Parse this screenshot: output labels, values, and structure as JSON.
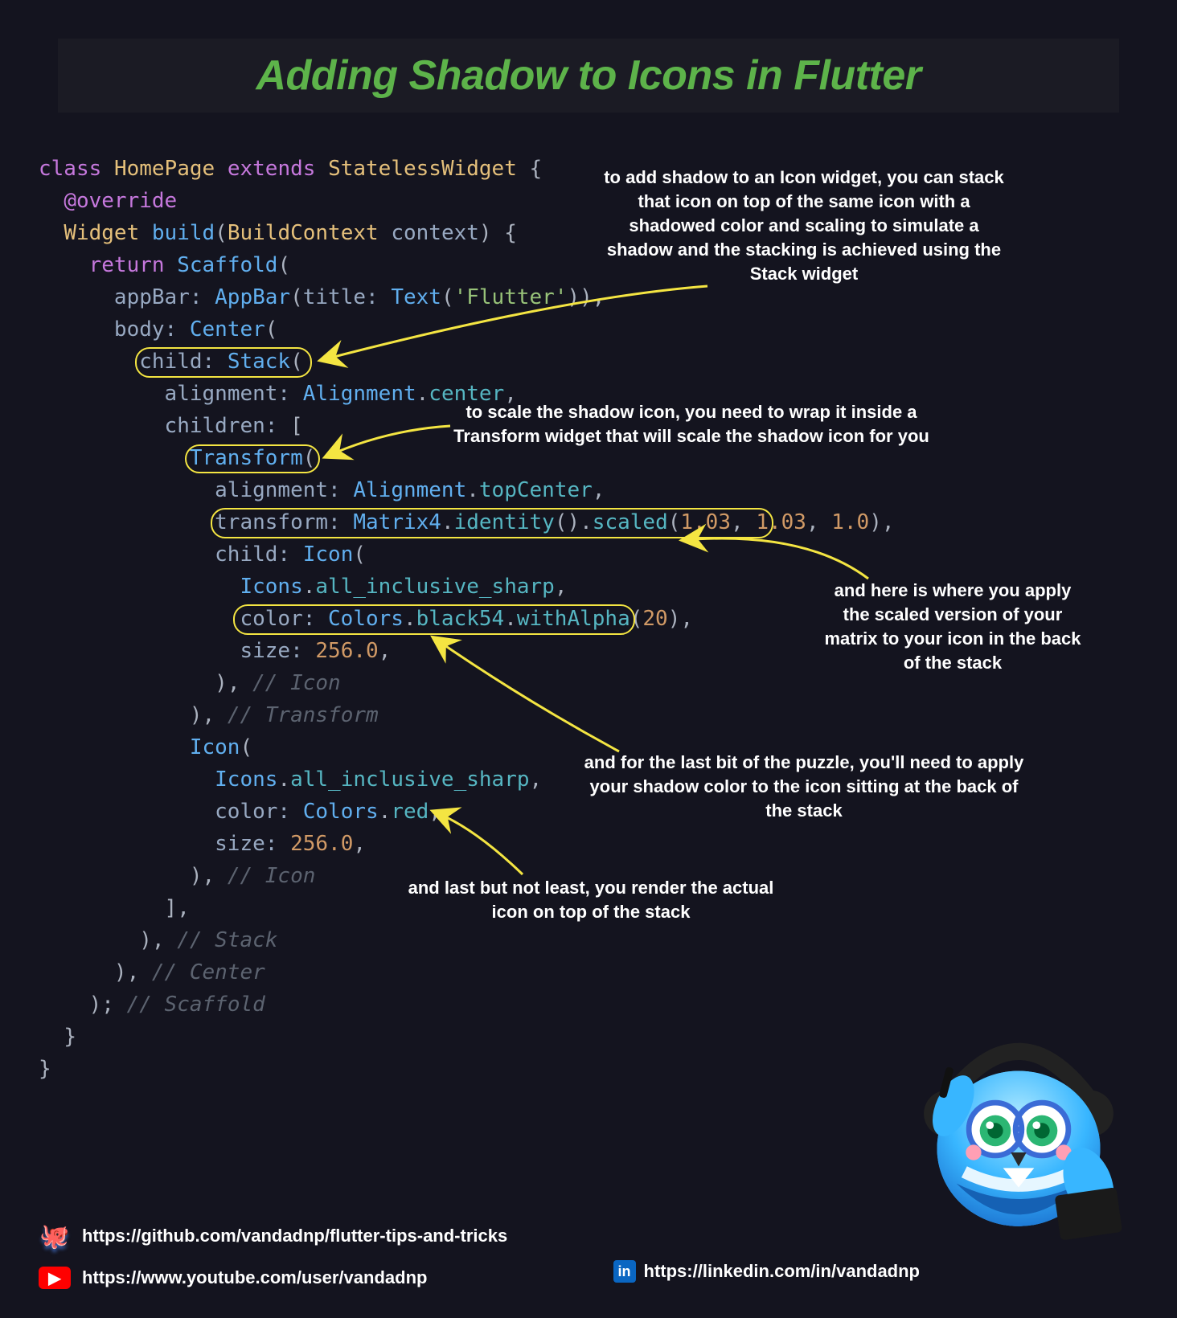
{
  "title": "Adding Shadow to Icons in Flutter",
  "annotations": {
    "stack": "to add shadow to an Icon widget, you can stack that icon on top of the same icon with a shadowed color and scaling to simulate a shadow and the stacking is achieved using the Stack widget",
    "transform": "to scale the shadow icon, you need to wrap it inside a Transform widget that will scale the shadow icon for you",
    "scaled": "and here is where you apply the scaled version of your matrix to your icon in the back of the stack",
    "shadowColor": "and for the last bit of the puzzle, you'll need to apply your shadow color to the icon sitting at the back of the stack",
    "actualIcon": "and last but not least, you render the actual icon on top of the stack"
  },
  "code": {
    "tokens": [
      [
        "kw",
        "class"
      ],
      [
        "",
        " "
      ],
      [
        "type",
        "HomePage"
      ],
      [
        "",
        " "
      ],
      [
        "kw",
        "extends"
      ],
      [
        "",
        " "
      ],
      [
        "type",
        "StatelessWidget"
      ],
      [
        "",
        " "
      ],
      [
        "pun",
        "{"
      ],
      [
        "nl"
      ],
      [
        "",
        "  "
      ],
      [
        "at",
        "@override"
      ],
      [
        "nl"
      ],
      [
        "",
        "  "
      ],
      [
        "type",
        "Widget"
      ],
      [
        "",
        " "
      ],
      [
        "fn",
        "build"
      ],
      [
        "pun",
        "("
      ],
      [
        "type",
        "BuildContext"
      ],
      [
        "",
        " "
      ],
      [
        "prop",
        "context"
      ],
      [
        "pun",
        ")"
      ],
      [
        "",
        " "
      ],
      [
        "pun",
        "{"
      ],
      [
        "nl"
      ],
      [
        "",
        "    "
      ],
      [
        "kw",
        "return"
      ],
      [
        "",
        " "
      ],
      [
        "fn",
        "Scaffold"
      ],
      [
        "pun",
        "("
      ],
      [
        "nl"
      ],
      [
        "",
        "      "
      ],
      [
        "prop",
        "appBar:"
      ],
      [
        "",
        " "
      ],
      [
        "fn",
        "AppBar"
      ],
      [
        "pun",
        "("
      ],
      [
        "prop",
        "title:"
      ],
      [
        "",
        " "
      ],
      [
        "fn",
        "Text"
      ],
      [
        "pun",
        "("
      ],
      [
        "str",
        "'Flutter'"
      ],
      [
        "pun",
        "))"
      ],
      [
        "pun",
        ","
      ],
      [
        "nl"
      ],
      [
        "",
        "      "
      ],
      [
        "prop",
        "body:"
      ],
      [
        "",
        " "
      ],
      [
        "fn",
        "Center"
      ],
      [
        "pun",
        "("
      ],
      [
        "nl"
      ],
      [
        "",
        "        "
      ],
      [
        "prop",
        "child:"
      ],
      [
        "",
        " "
      ],
      [
        "fn",
        "Stack"
      ],
      [
        "pun",
        "("
      ],
      [
        "nl"
      ],
      [
        "",
        "          "
      ],
      [
        "prop",
        "alignment:"
      ],
      [
        "",
        " "
      ],
      [
        "fn",
        "Alignment"
      ],
      [
        "pun",
        "."
      ],
      [
        "mem",
        "center"
      ],
      [
        "pun",
        ","
      ],
      [
        "nl"
      ],
      [
        "",
        "          "
      ],
      [
        "prop",
        "children:"
      ],
      [
        "",
        " "
      ],
      [
        "pun",
        "["
      ],
      [
        "nl"
      ],
      [
        "",
        "            "
      ],
      [
        "fn",
        "Transform"
      ],
      [
        "pun",
        "("
      ],
      [
        "nl"
      ],
      [
        "",
        "              "
      ],
      [
        "prop",
        "alignment:"
      ],
      [
        "",
        " "
      ],
      [
        "fn",
        "Alignment"
      ],
      [
        "pun",
        "."
      ],
      [
        "mem",
        "topCenter"
      ],
      [
        "pun",
        ","
      ],
      [
        "nl"
      ],
      [
        "",
        "              "
      ],
      [
        "prop",
        "transform:"
      ],
      [
        "",
        " "
      ],
      [
        "fn",
        "Matrix4"
      ],
      [
        "pun",
        "."
      ],
      [
        "mem",
        "identity"
      ],
      [
        "pun",
        "()"
      ],
      [
        "pun",
        "."
      ],
      [
        "mem",
        "scaled"
      ],
      [
        "pun",
        "("
      ],
      [
        "num",
        "1.03"
      ],
      [
        "pun",
        ", "
      ],
      [
        "num",
        "1.03"
      ],
      [
        "pun",
        ", "
      ],
      [
        "num",
        "1.0"
      ],
      [
        "pun",
        ")"
      ],
      [
        "pun",
        ","
      ],
      [
        "nl"
      ],
      [
        "",
        "              "
      ],
      [
        "prop",
        "child:"
      ],
      [
        "",
        " "
      ],
      [
        "fn",
        "Icon"
      ],
      [
        "pun",
        "("
      ],
      [
        "nl"
      ],
      [
        "",
        "                "
      ],
      [
        "fn",
        "Icons"
      ],
      [
        "pun",
        "."
      ],
      [
        "mem",
        "all_inclusive_sharp"
      ],
      [
        "pun",
        ","
      ],
      [
        "nl"
      ],
      [
        "",
        "                "
      ],
      [
        "prop",
        "color:"
      ],
      [
        "",
        " "
      ],
      [
        "fn",
        "Colors"
      ],
      [
        "pun",
        "."
      ],
      [
        "mem",
        "black54"
      ],
      [
        "pun",
        "."
      ],
      [
        "mem",
        "withAlpha"
      ],
      [
        "pun",
        "("
      ],
      [
        "num",
        "20"
      ],
      [
        "pun",
        ")"
      ],
      [
        "pun",
        ","
      ],
      [
        "nl"
      ],
      [
        "",
        "                "
      ],
      [
        "prop",
        "size:"
      ],
      [
        "",
        " "
      ],
      [
        "num",
        "256.0"
      ],
      [
        "pun",
        ","
      ],
      [
        "nl"
      ],
      [
        "",
        "              "
      ],
      [
        "pun",
        ")"
      ],
      [
        "pun",
        ","
      ],
      [
        "",
        " "
      ],
      [
        "cmt",
        "// Icon"
      ],
      [
        "nl"
      ],
      [
        "",
        "            "
      ],
      [
        "pun",
        ")"
      ],
      [
        "pun",
        ","
      ],
      [
        "",
        " "
      ],
      [
        "cmt",
        "// Transform"
      ],
      [
        "nl"
      ],
      [
        "",
        "            "
      ],
      [
        "fn",
        "Icon"
      ],
      [
        "pun",
        "("
      ],
      [
        "nl"
      ],
      [
        "",
        "              "
      ],
      [
        "fn",
        "Icons"
      ],
      [
        "pun",
        "."
      ],
      [
        "mem",
        "all_inclusive_sharp"
      ],
      [
        "pun",
        ","
      ],
      [
        "nl"
      ],
      [
        "",
        "              "
      ],
      [
        "prop",
        "color:"
      ],
      [
        "",
        " "
      ],
      [
        "fn",
        "Colors"
      ],
      [
        "pun",
        "."
      ],
      [
        "mem",
        "red"
      ],
      [
        "pun",
        ","
      ],
      [
        "nl"
      ],
      [
        "",
        "              "
      ],
      [
        "prop",
        "size:"
      ],
      [
        "",
        " "
      ],
      [
        "num",
        "256.0"
      ],
      [
        "pun",
        ","
      ],
      [
        "nl"
      ],
      [
        "",
        "            "
      ],
      [
        "pun",
        ")"
      ],
      [
        "pun",
        ","
      ],
      [
        "",
        " "
      ],
      [
        "cmt",
        "// Icon"
      ],
      [
        "nl"
      ],
      [
        "",
        "          "
      ],
      [
        "pun",
        "]"
      ],
      [
        "pun",
        ","
      ],
      [
        "nl"
      ],
      [
        "",
        "        "
      ],
      [
        "pun",
        ")"
      ],
      [
        "pun",
        ","
      ],
      [
        "",
        " "
      ],
      [
        "cmt",
        "// Stack"
      ],
      [
        "nl"
      ],
      [
        "",
        "      "
      ],
      [
        "pun",
        ")"
      ],
      [
        "pun",
        ","
      ],
      [
        "",
        " "
      ],
      [
        "cmt",
        "// Center"
      ],
      [
        "nl"
      ],
      [
        "",
        "    "
      ],
      [
        "pun",
        ")"
      ],
      [
        "pun",
        ";"
      ],
      [
        "",
        " "
      ],
      [
        "cmt",
        "// Scaffold"
      ],
      [
        "nl"
      ],
      [
        "",
        "  "
      ],
      [
        "pun",
        "}"
      ],
      [
        "nl"
      ],
      [
        "pun",
        "}"
      ]
    ]
  },
  "links": {
    "github": "https://github.com/vandadnp/flutter-tips-and-tricks",
    "youtube": "https://www.youtube.com/user/vandadnp",
    "linkedin": "https://linkedin.com/in/vandadnp"
  }
}
